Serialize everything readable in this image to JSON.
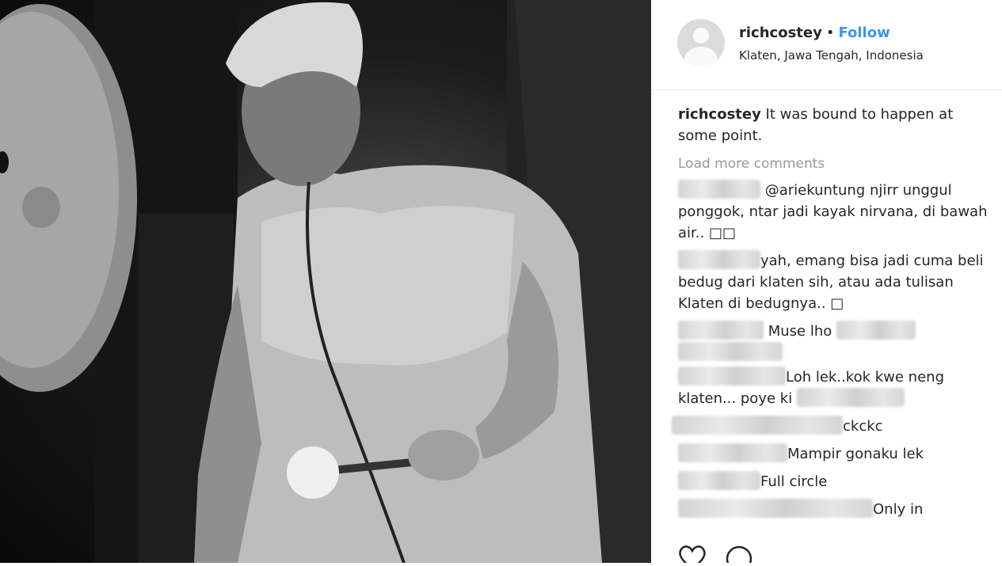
{
  "post": {
    "username": "richcostey",
    "separator": "•",
    "follow_label": "Follow",
    "location": "Klaten, Jawa Tengah, Indonesia"
  },
  "caption": {
    "username": "richcostey",
    "text": " It was bound to happen at some point."
  },
  "load_more_label": "Load more comments",
  "comments": [
    {
      "text_a": "@ariekuntung njirr unggul ponggok, ntar jadi kayak nirvana, di bawah air.. □□"
    },
    {
      "text_a": "yah, emang bisa jadi cuma beli bedug dari klaten sih, atau ada tulisan Klaten di bedugnya.. □"
    },
    {
      "text_a": "Muse lho"
    },
    {
      "text_a": "Loh lek..kok kwe neng klaten... poye ki"
    },
    {
      "text_a": "ckckc"
    },
    {
      "text_a": "Mampir gonaku lek"
    },
    {
      "text_a": "Full circle"
    },
    {
      "text_a": "Only in"
    }
  ],
  "icons": [
    "heart-icon",
    "comment-icon",
    "avatar-placeholder-icon"
  ],
  "colors": {
    "follow": "#3897f0",
    "muted": "#999999",
    "text": "#262626"
  }
}
